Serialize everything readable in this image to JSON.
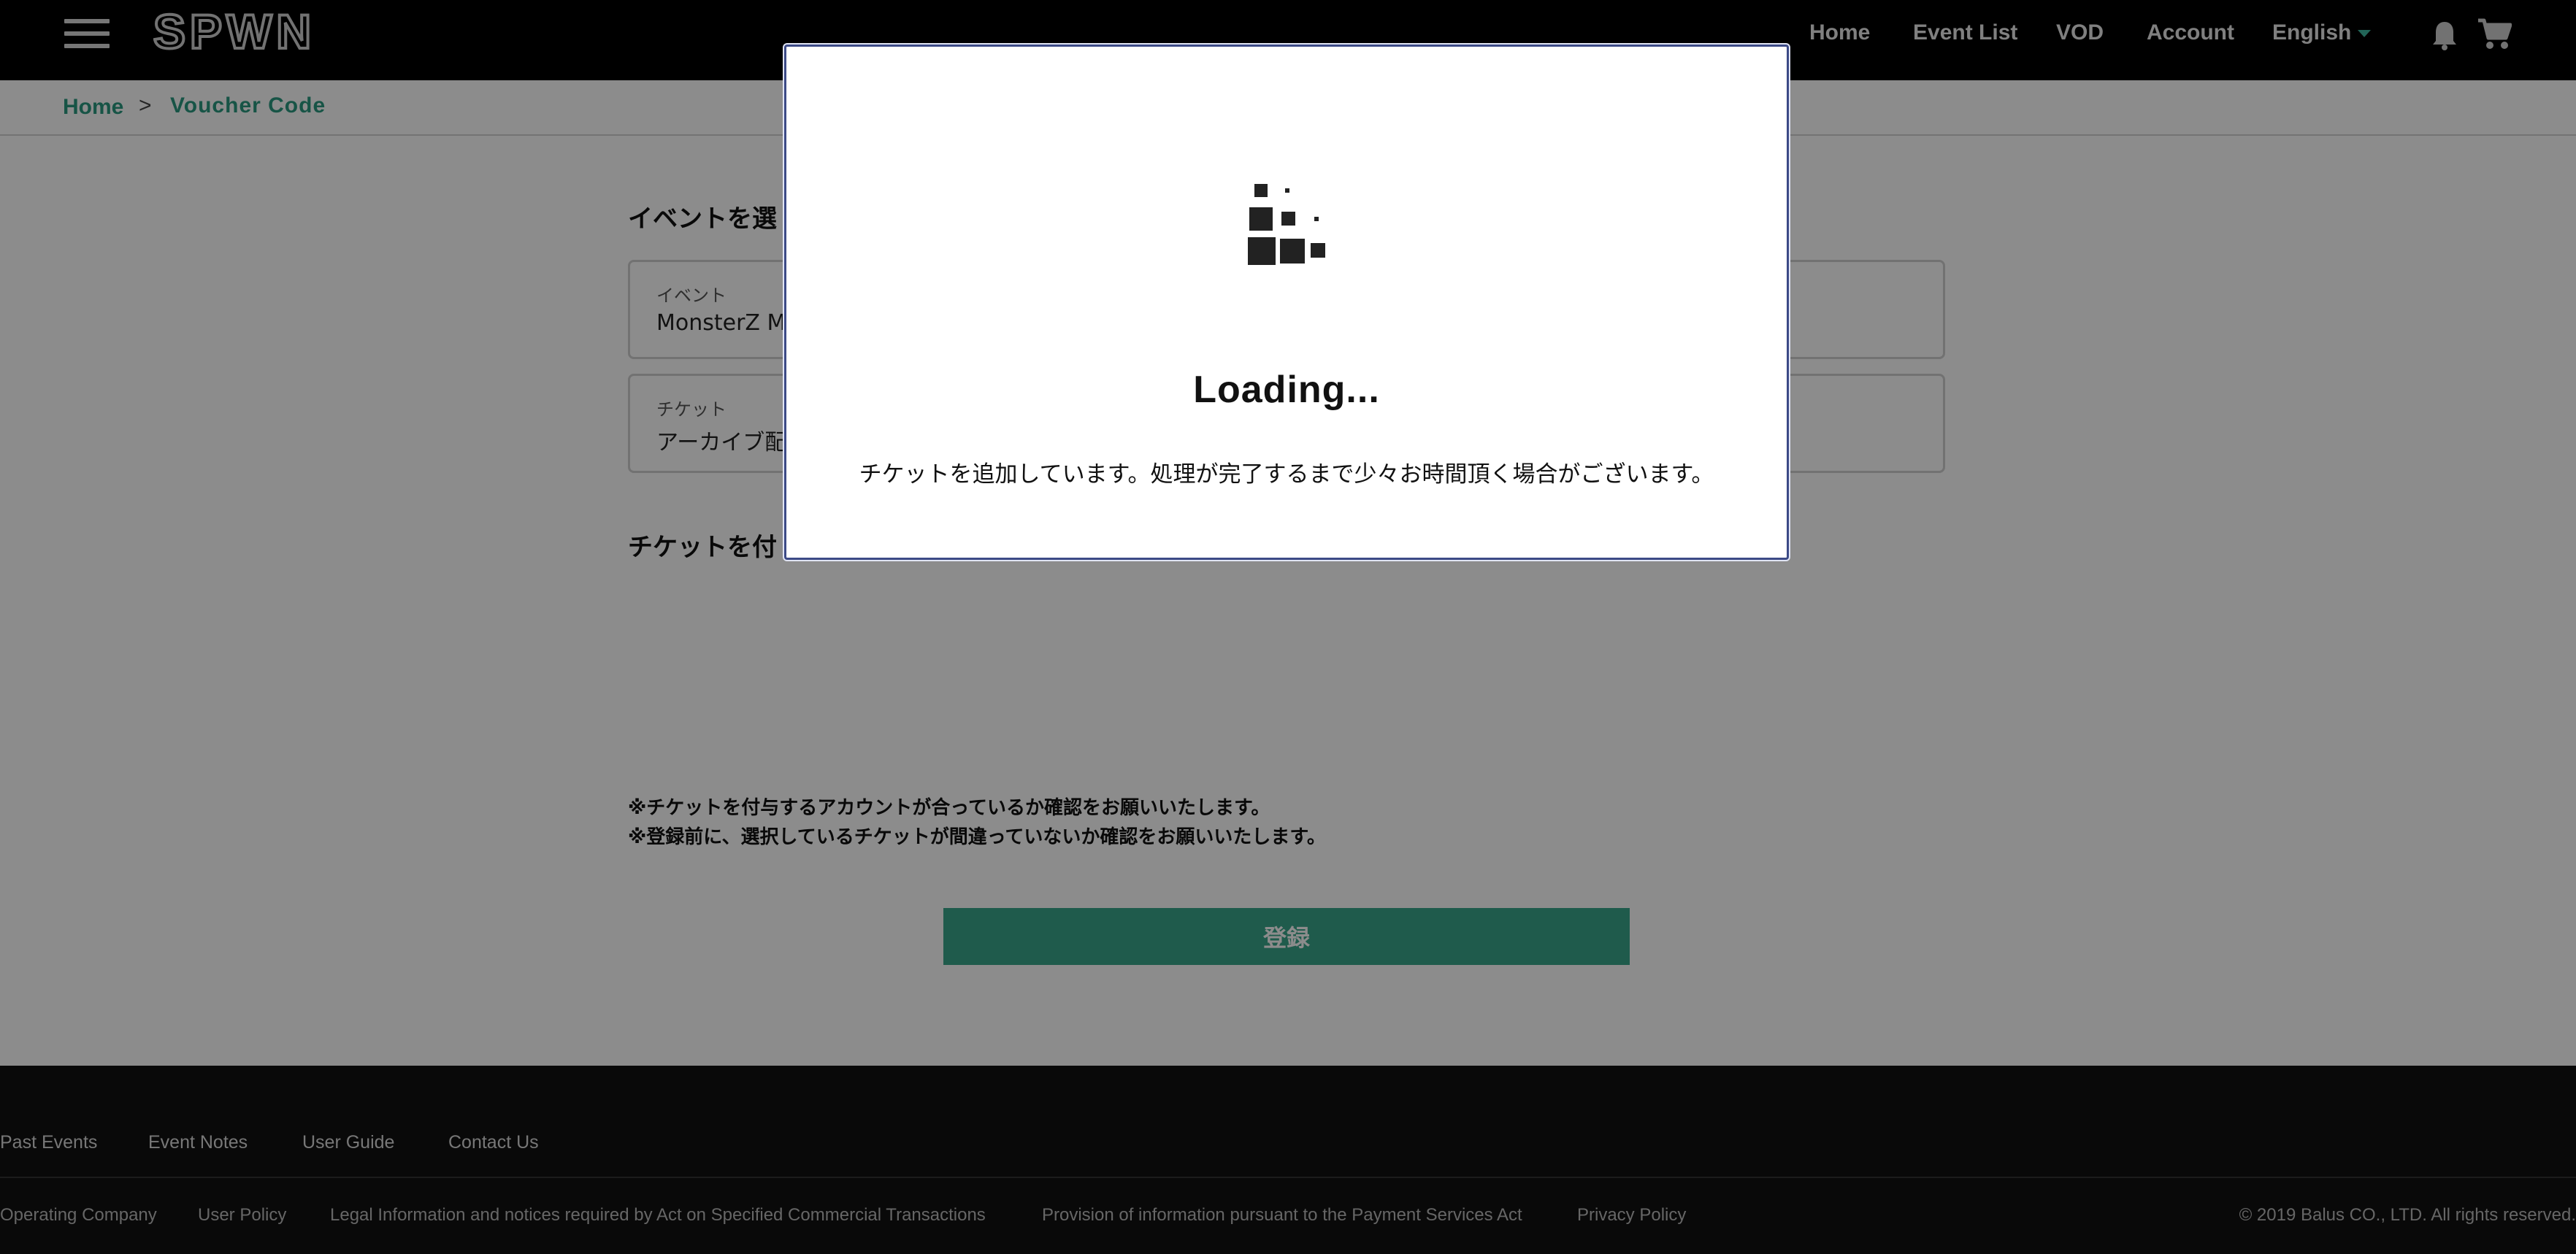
{
  "header": {
    "logo_text": "SPWN",
    "nav": {
      "home": "Home",
      "event_list": "Event List",
      "vod": "VOD",
      "account": "Account",
      "language": "English"
    }
  },
  "breadcrumb": {
    "home": "Home",
    "separator": ">",
    "current": "Voucher Code"
  },
  "main": {
    "select_event_title": "イベントを選",
    "event_field": {
      "label": "イベント",
      "value": "MonsterZ MA"
    },
    "ticket_field": {
      "label": "チケット",
      "value": "アーカイブ配"
    },
    "grant_ticket_title": "チケットを付",
    "notes": [
      "※チケットを付与するアカウントが合っているか確認をお願いいたします。",
      "※登録前に、選択しているチケットが間違っていないか確認をお願いいたします。"
    ],
    "register_button": "登録"
  },
  "footer": {
    "links": [
      "Past Events",
      "Event Notes",
      "User Guide",
      "Contact Us"
    ],
    "legal_links": [
      "Operating Company",
      "User Policy",
      "Legal Information and notices required by Act on Specified Commercial Transactions",
      "Provision of information pursuant to the Payment Services Act",
      "Privacy Policy"
    ],
    "copyright": "© 2019 Balus CO., LTD. All rights reserved."
  },
  "modal": {
    "title": "Loading...",
    "message": "チケットを追加しています。処理が完了するまで少々お時間頂く場合がございます。"
  },
  "colors": {
    "accent": "#2a9a80",
    "button": "#3aa68a",
    "header_bg": "#000000",
    "footer_bg": "#111111",
    "modal_border": "#3c4a86"
  }
}
